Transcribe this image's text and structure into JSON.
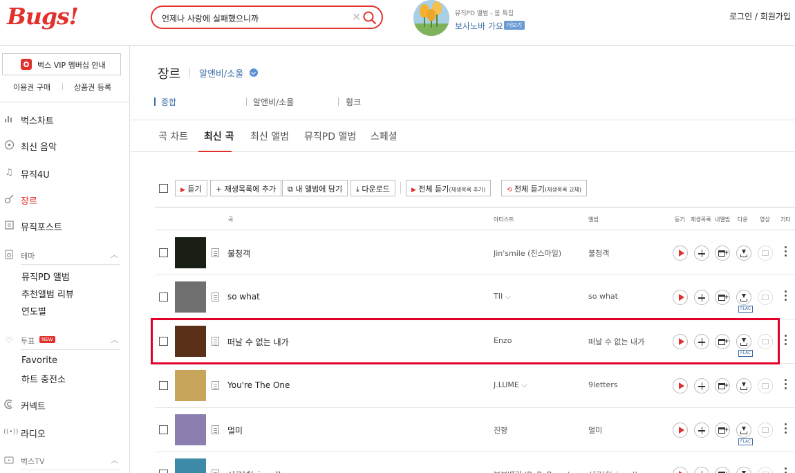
{
  "header": {
    "logo": "Bugs!",
    "search_value": "언제나 사랑에 실패했으니까",
    "promo": {
      "subtitle": "뮤직PD 앨범 - 봄 특집",
      "title": "보사노바 가요",
      "more": "더보기"
    },
    "login": "로그인 / 회원가입"
  },
  "sidebar": {
    "vip": "벅스 VIP 멤버십 안내",
    "sub_links": [
      "이용권 구매",
      "상품권 등록"
    ],
    "items": [
      {
        "label": "벅스차트",
        "icon": "chart-icon"
      },
      {
        "label": "최신 음악",
        "icon": "disc-icon"
      },
      {
        "label": "뮤직4U",
        "icon": "note-icon"
      },
      {
        "label": "장르",
        "icon": "guitar-icon"
      },
      {
        "label": "뮤직포스트",
        "icon": "post-icon"
      }
    ],
    "theme_group": {
      "label": "테마",
      "items": [
        "뮤직PD 앨범",
        "추천앨범 리뷰",
        "연도별"
      ]
    },
    "vote_group": {
      "label": "투표",
      "badge": "NEW",
      "items": [
        "Favorite",
        "하트 충전소"
      ]
    },
    "items2": [
      {
        "label": "커넥트",
        "icon": "connect-icon"
      },
      {
        "label": "라디오",
        "icon": "radio-icon"
      }
    ],
    "tv_group": {
      "label": "벅스TV"
    }
  },
  "main": {
    "title": "장르",
    "genre": "알앤비/소울",
    "subtabs": [
      "종합",
      "알앤비/소울",
      "휭크"
    ],
    "tabs": [
      "곡 차트",
      "최신 곡",
      "최신 앨범",
      "뮤직PD 앨범",
      "스페셜"
    ],
    "toolbar": {
      "listen": "듣기",
      "add_playlist": "재생목록에 추가",
      "add_album": "내 앨범에 담기",
      "download": "다운로드",
      "all_listen": "전체 듣기",
      "all_listen_note": "(재생목록 추가)",
      "all_listen2": "전체 듣기",
      "all_listen2_note": "(재생목록 교체)"
    },
    "columns": [
      "곡",
      "아티스트",
      "앨범",
      "듣기",
      "재생목록",
      "내앨범",
      "다운",
      "영상",
      "기타"
    ],
    "rows": [
      {
        "song": "불청객",
        "artist": "Jin'smile (진스마일)",
        "album": "불청객",
        "flac": false,
        "cover": "#1a1f16"
      },
      {
        "song": "so what",
        "artist": "TII",
        "artist_more": true,
        "album": "so what",
        "flac": true,
        "cover": "#6f6f6f"
      },
      {
        "song": "떠날 수 없는 내가",
        "artist": "Enzo",
        "album": "떠날 수 없는 내가",
        "flac": true,
        "cover": "#5a3018"
      },
      {
        "song": "You're The One",
        "artist": "J.LUME",
        "artist_more": true,
        "album": "9letters",
        "flac": false,
        "cover": "#c8a55a"
      },
      {
        "song": "멀미",
        "artist": "진향",
        "album": "멀미",
        "flac": true,
        "cover": "#8c7fb0"
      },
      {
        "song": "시그널(signal)",
        "artist": "보보베리 (BoBoBerry)",
        "artist_more": true,
        "album": "시그널(signal)",
        "flac": false,
        "cover": "#3d8aa8"
      }
    ]
  },
  "colors": {
    "accent": "#e2302d",
    "link": "#3b6ea8",
    "highlight": "#e2002a"
  }
}
